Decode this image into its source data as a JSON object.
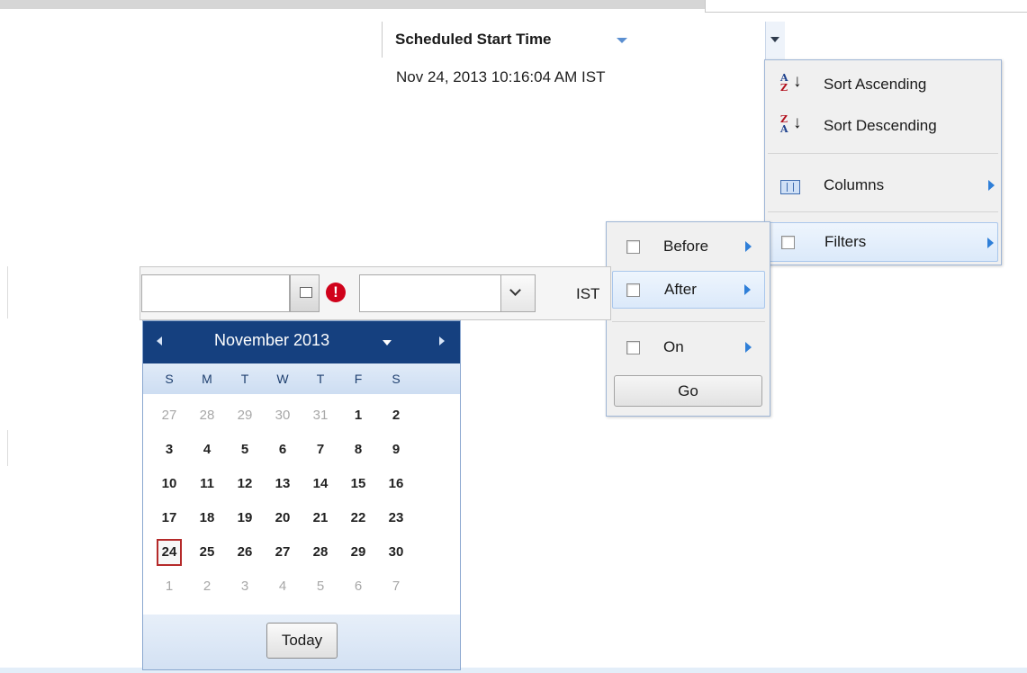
{
  "grid": {
    "column_title": "Scheduled Start Time",
    "cell_value": "Nov 24, 2013 10:16:04 AM IST"
  },
  "column_menu": {
    "items": [
      {
        "label": "Sort Ascending",
        "icon": "sort-ascending-icon"
      },
      {
        "label": "Sort Descending",
        "icon": "sort-descending-icon"
      },
      {
        "label": "Columns",
        "icon": "columns-icon"
      },
      {
        "label": "Filters",
        "icon": "checkbox"
      }
    ],
    "sort_icon_letters": {
      "a": "A",
      "z": "Z"
    }
  },
  "filter_menu": {
    "items": [
      {
        "label": "Before"
      },
      {
        "label": "After"
      },
      {
        "label": "On"
      }
    ],
    "go_label": "Go"
  },
  "editor": {
    "date_value": "",
    "time_value": "",
    "timezone": "IST",
    "error_glyph": "!"
  },
  "calendar": {
    "month_label": "November 2013",
    "weekdays": [
      "S",
      "M",
      "T",
      "W",
      "T",
      "F",
      "S"
    ],
    "weeks": [
      [
        "27",
        "28",
        "29",
        "30",
        "31",
        "1",
        "2"
      ],
      [
        "3",
        "4",
        "5",
        "6",
        "7",
        "8",
        "9"
      ],
      [
        "10",
        "11",
        "12",
        "13",
        "14",
        "15",
        "16"
      ],
      [
        "17",
        "18",
        "19",
        "20",
        "21",
        "22",
        "23"
      ],
      [
        "24",
        "25",
        "26",
        "27",
        "28",
        "29",
        "30"
      ],
      [
        "1",
        "2",
        "3",
        "4",
        "5",
        "6",
        "7"
      ]
    ],
    "selected_day": "24",
    "today_label": "Today",
    "colors": {
      "header": "#15407f",
      "today_border": "#b52a2a",
      "muted": "#a7a7a7"
    }
  }
}
